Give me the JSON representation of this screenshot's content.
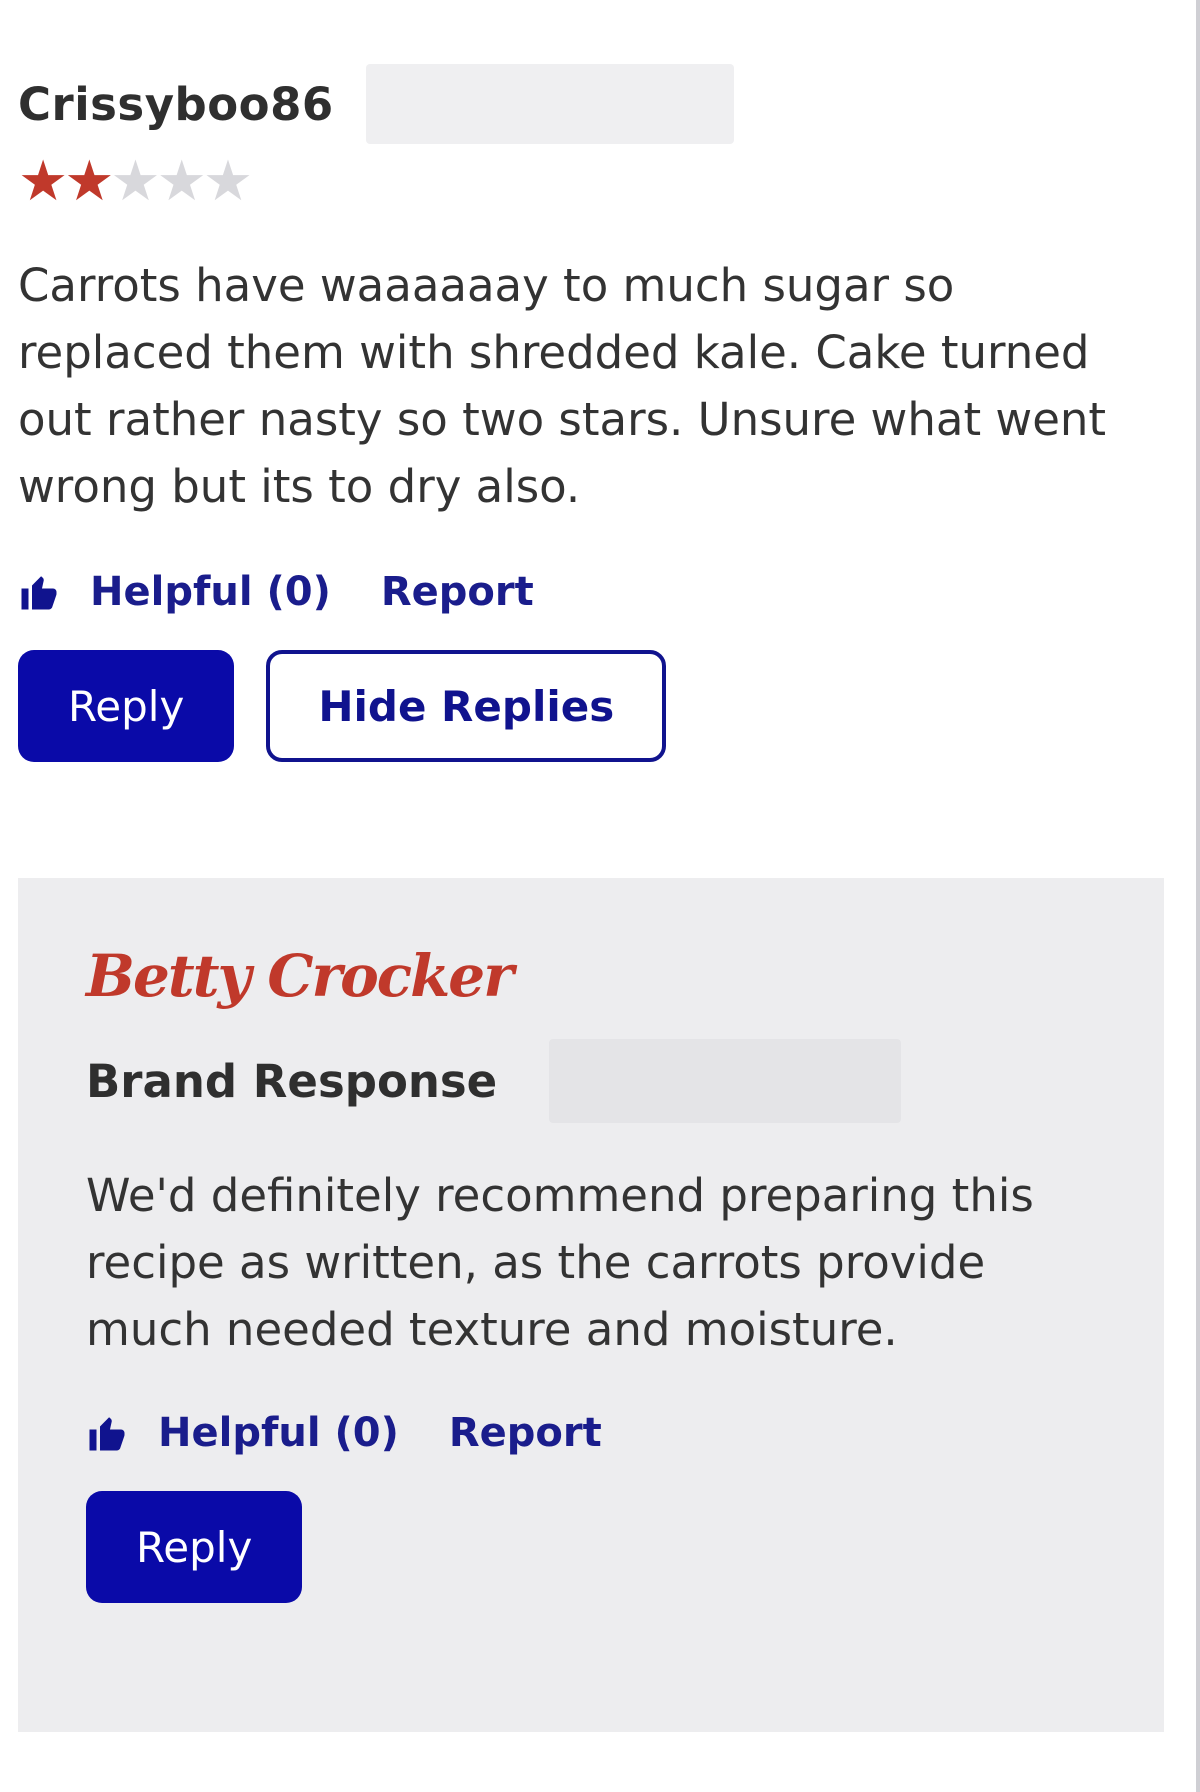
{
  "review": {
    "username": "Crissyboo86",
    "rating": 2,
    "rating_max": 5,
    "text": "Carrots have waaaaaay to much sugar so replaced them with shredded kale. Cake turned out rather nasty so two stars. Unsure what went wrong but its to dry also.",
    "helpful_label": "Helpful (0)",
    "report_label": "Report",
    "reply_label": "Reply",
    "hide_replies_label": "Hide Replies"
  },
  "response": {
    "logo_text": "Betty Crocker",
    "title": "Brand Response",
    "text": "We'd definitely recommend preparing this recipe as written, as the carrots provide much needed texture and moisture.",
    "helpful_label": "Helpful (0)",
    "report_label": "Report",
    "reply_label": "Reply"
  },
  "colors": {
    "star_filled": "#c0392b",
    "star_empty": "#d8d8dc",
    "primary_button": "#0a0aa8",
    "link": "#1a1d8c",
    "brand_red": "#c0392b",
    "response_bg": "#ededef"
  },
  "icons": {
    "star": "star-icon",
    "helpful": "thumbs-up-icon"
  }
}
